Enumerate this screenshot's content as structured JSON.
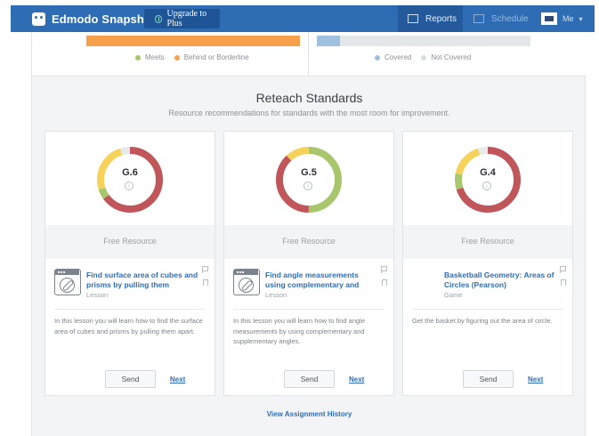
{
  "navbar": {
    "brand": "Edmodo Snapshot",
    "upgrade_label": "Upgrade to Plus",
    "reports_label": "Reports",
    "schedule_label": "Schedule",
    "me_label": "Me"
  },
  "summary": {
    "performance_legend": [
      {
        "label": "Meets",
        "color": "#a8c66c"
      },
      {
        "label": "Behind or Borderline",
        "color": "#f7a04b"
      }
    ],
    "coverage_legend": [
      {
        "label": "Covered",
        "color": "#9fc0df"
      },
      {
        "label": "Not Covered",
        "color": "#d9dde1"
      }
    ],
    "coverage_fraction": 0.11
  },
  "reteach": {
    "title": "Reteach Standards",
    "subtitle": "Resource recommendations for standards with the most room for improvement."
  },
  "cards": [
    {
      "code": "G.6",
      "info": "i",
      "ring": [
        {
          "value": 0.65,
          "color": "#c0555a"
        },
        {
          "value": 0.05,
          "color": "#a8c66c"
        },
        {
          "value": 0.25,
          "color": "#f6d25a"
        },
        {
          "value": 0.05,
          "color": "#e8e9eb"
        }
      ],
      "free_label": "Free Resource",
      "title": "Find surface area of cubes and prisms by pulling them",
      "type": "Lesson",
      "description": "In this lesson you will learn how to find the surface area of cubes and prisms by pulling them apart.",
      "send_label": "Send",
      "next_label": "Next"
    },
    {
      "code": "G.5",
      "info": "i",
      "ring": [
        {
          "value": 0.5,
          "color": "#a8c66c"
        },
        {
          "value": 0.38,
          "color": "#c0555a"
        },
        {
          "value": 0.12,
          "color": "#f6d25a"
        }
      ],
      "free_label": "Free Resource",
      "title": "Find angle measurements using complementary and",
      "type": "Lesson",
      "description": "In this lesson you will learn how to find angle measurements by using complementary and supplementary angles.",
      "send_label": "Send",
      "next_label": "Next"
    },
    {
      "code": "G.4",
      "info": "i",
      "ring": [
        {
          "value": 0.7,
          "color": "#c0555a"
        },
        {
          "value": 0.08,
          "color": "#a8c66c"
        },
        {
          "value": 0.17,
          "color": "#f6d25a"
        },
        {
          "value": 0.05,
          "color": "#e8e9eb"
        }
      ],
      "free_label": "Free Resource",
      "title": "Basketball Geometry: Areas of Circles (Pearson)",
      "type": "Game",
      "description": "Get the basket by figuring out the area of circle.",
      "send_label": "Send",
      "next_label": "Next"
    }
  ],
  "history_link": "View Assignment History"
}
